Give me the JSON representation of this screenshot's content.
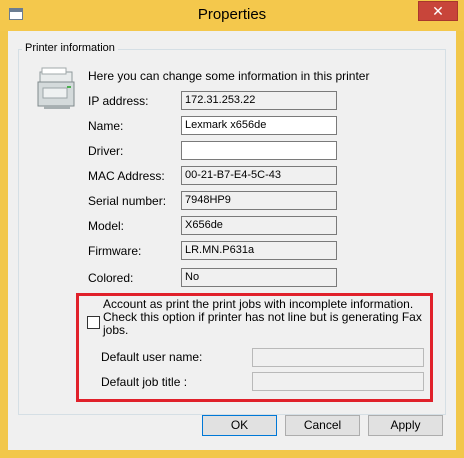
{
  "window": {
    "title": "Properties",
    "close_glyph": "✕"
  },
  "group": {
    "legend": "Printer information",
    "intro": "Here you can change some information in this printer"
  },
  "fields": [
    {
      "label": "IP address:",
      "value": "172.31.253.22",
      "editable": false
    },
    {
      "label": "Name:",
      "value": "Lexmark x656de",
      "editable": true
    },
    {
      "label": "Driver:",
      "value": "",
      "editable": true
    },
    {
      "label": "MAC Address:",
      "value": "00-21-B7-E4-5C-43",
      "editable": false
    },
    {
      "label": "Serial number:",
      "value": "7948HP9",
      "editable": false
    },
    {
      "label": "Model:",
      "value": "X656de",
      "editable": false
    },
    {
      "label": "Firmware:",
      "value": "LR.MN.P631a",
      "editable": false
    },
    {
      "label": "Colored:",
      "value": "No",
      "editable": false
    }
  ],
  "account": {
    "checked": false,
    "line1": "Account as print the print jobs with incomplete information.",
    "line2": "Check this option if printer has not line but  is generating Fax jobs.",
    "default_user_label": "Default user name:",
    "default_user_value": "",
    "default_title_label": "Default job title :",
    "default_title_value": ""
  },
  "buttons": {
    "ok": "OK",
    "cancel": "Cancel",
    "apply": "Apply"
  },
  "colors": {
    "title_bar": "#f4c84c",
    "close": "#c8453a",
    "highlight": "#e0202a"
  }
}
